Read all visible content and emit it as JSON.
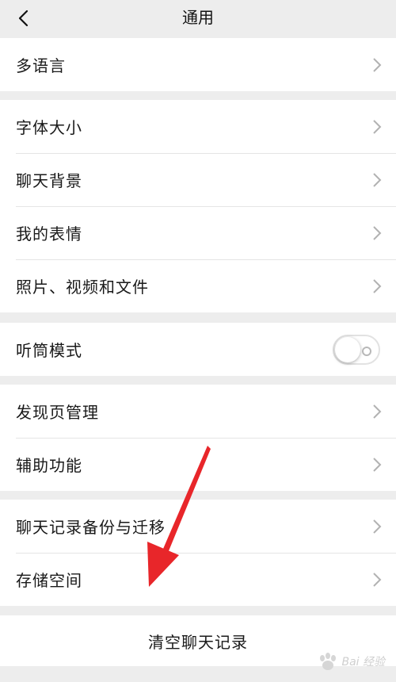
{
  "nav": {
    "title": "通用",
    "back_icon": "chevron-left-icon"
  },
  "groups": [
    {
      "items": [
        {
          "label": "多语言"
        }
      ]
    },
    {
      "items": [
        {
          "label": "字体大小"
        },
        {
          "label": "聊天背景"
        },
        {
          "label": "我的表情"
        },
        {
          "label": "照片、视频和文件"
        }
      ]
    },
    {
      "items": [
        {
          "label": "听筒模式",
          "toggle": "off"
        }
      ]
    },
    {
      "items": [
        {
          "label": "发现页管理"
        },
        {
          "label": "辅助功能"
        }
      ]
    },
    {
      "items": [
        {
          "label": "聊天记录备份与迁移"
        },
        {
          "label": "存储空间"
        }
      ]
    }
  ],
  "action": {
    "label": "清空聊天记录"
  },
  "annotation": {
    "arrow_color": "#e8262a"
  },
  "watermark": {
    "text": "Bai 经验"
  },
  "colors": {
    "background": "#ededed",
    "card": "#ffffff",
    "separator": "#e5e5e5",
    "text": "#191919"
  }
}
